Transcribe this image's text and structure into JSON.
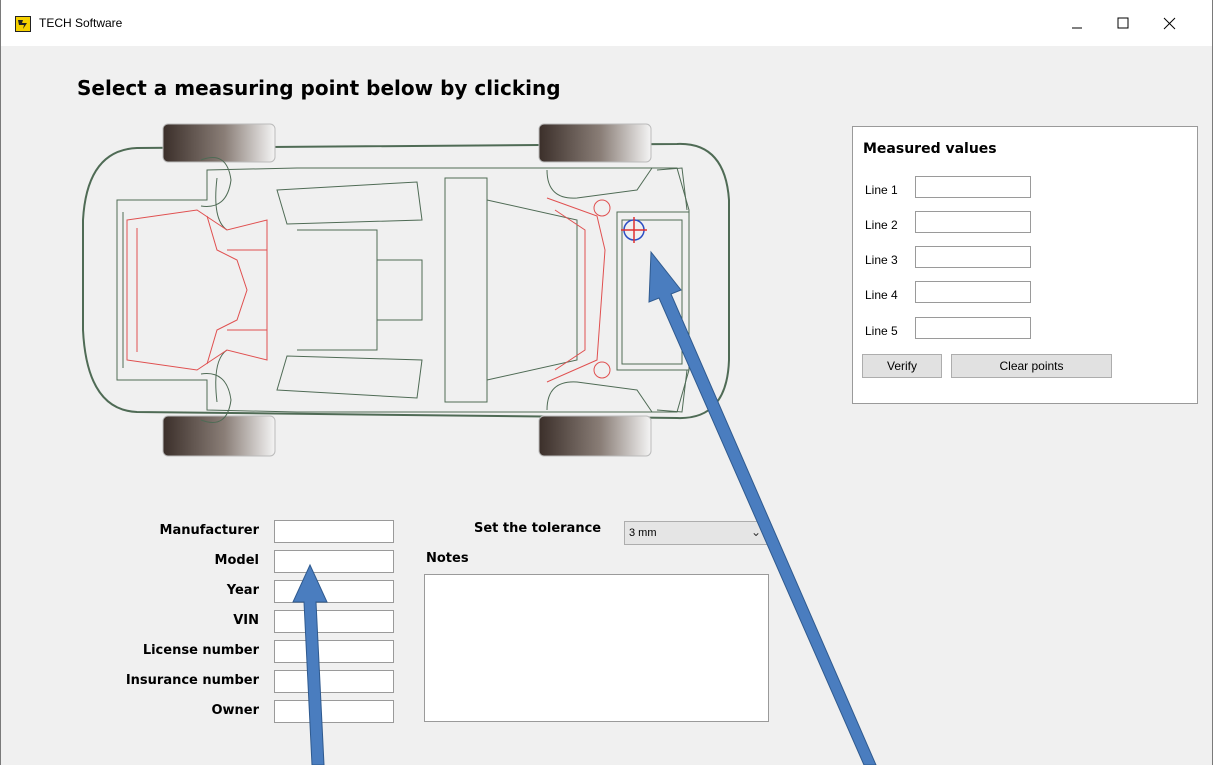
{
  "window": {
    "title": "TECH Software",
    "minimize_glyph": "—",
    "maximize_glyph": "☐",
    "close_glyph": "✕"
  },
  "heading": "Select a measuring point below by clicking",
  "measured_values": {
    "title": "Measured values",
    "lines": [
      {
        "label": "Line 1",
        "value": ""
      },
      {
        "label": "Line 2",
        "value": ""
      },
      {
        "label": "Line 3",
        "value": ""
      },
      {
        "label": "Line 4",
        "value": ""
      },
      {
        "label": "Line 5",
        "value": ""
      }
    ],
    "verify_label": "Verify",
    "clear_label": "Clear points"
  },
  "vehicle_form": {
    "fields": [
      {
        "label": "Manufacturer",
        "value": ""
      },
      {
        "label": "Model",
        "value": ""
      },
      {
        "label": "Year",
        "value": ""
      },
      {
        "label": "VIN",
        "value": ""
      },
      {
        "label": "License number",
        "value": ""
      },
      {
        "label": "Insurance number",
        "value": ""
      },
      {
        "label": "Owner",
        "value": ""
      }
    ]
  },
  "tolerance": {
    "label": "Set the tolerance",
    "selected": "3 mm"
  },
  "notes": {
    "label": "Notes",
    "value": ""
  },
  "icons": {
    "app": "tech-logo-icon",
    "target": "crosshair-icon",
    "chevron": "chevron-down-icon"
  },
  "colors": {
    "frame": "#4f6b55",
    "chassis": "#e05050",
    "target": "#2c4ec4",
    "arrow": "#4a7dbf"
  }
}
